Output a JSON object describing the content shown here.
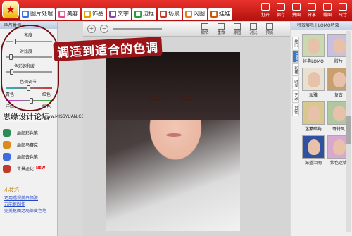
{
  "tabs": [
    {
      "label": "图片处理",
      "color": "#3a72d8",
      "icon": "image-icon"
    },
    {
      "label": "美容",
      "color": "#e64a8b",
      "icon": "beauty-icon"
    },
    {
      "label": "饰品",
      "color": "#e0a000",
      "icon": "accessory-icon"
    },
    {
      "label": "文字",
      "color": "#8e44ad",
      "icon": "text-icon"
    },
    {
      "label": "边框",
      "color": "#2b9c3a",
      "icon": "frame-icon"
    },
    {
      "label": "场景",
      "color": "#c0392b",
      "icon": "scene-icon"
    },
    {
      "label": "闪图",
      "color": "#e67e22",
      "icon": "flash-icon"
    },
    {
      "label": "娃娃",
      "color": "#d35400",
      "icon": "doll-icon"
    }
  ],
  "right_tools": [
    "打开",
    "保存",
    "拼图",
    "分享",
    "截图",
    "尺寸"
  ],
  "subbar": {
    "buttons": [
      "撤销",
      "重做",
      "原图",
      "对比",
      "预览"
    ]
  },
  "left_panel": {
    "header": "图片普调",
    "labels": {
      "brightness": "亮度",
      "contrast": "对比度",
      "saturation": "色彩饱和度",
      "color_adjust": "色调调节",
      "cyan": "青色",
      "red": "红色",
      "magenta": "洋红",
      "green": "绿色"
    },
    "caption": "思缘设计论坛",
    "watermark": "www.MISSYUAN.COM",
    "fx": [
      {
        "label": "局部彩色笔",
        "color": "#2e8b57"
      },
      {
        "label": "局部马赛克",
        "color": "#d98b1d"
      },
      {
        "label": "局部去色笔",
        "color": "#4169e1"
      },
      {
        "label": "背景虚化",
        "color": "#c0392b",
        "badge": "NEW"
      }
    ],
    "tip_header": "小技巧",
    "tips": [
      "巧用透视美白颜肤",
      "万能抠制作",
      "完美抠图之局部变色笔"
    ]
  },
  "title": "调适到适合的色调",
  "right_panel": {
    "header": "特效展示 | LOMO特效",
    "tabs": [
      "热门",
      "LOMO",
      "影楼",
      "时尚",
      "艺术",
      "其他"
    ],
    "thumbs": [
      "经典LOMO",
      "胶片",
      "淡雅",
      "复古",
      "迷蒙暗角",
      "哥特风",
      "深蓝泪雨",
      "紫色迷情"
    ]
  }
}
